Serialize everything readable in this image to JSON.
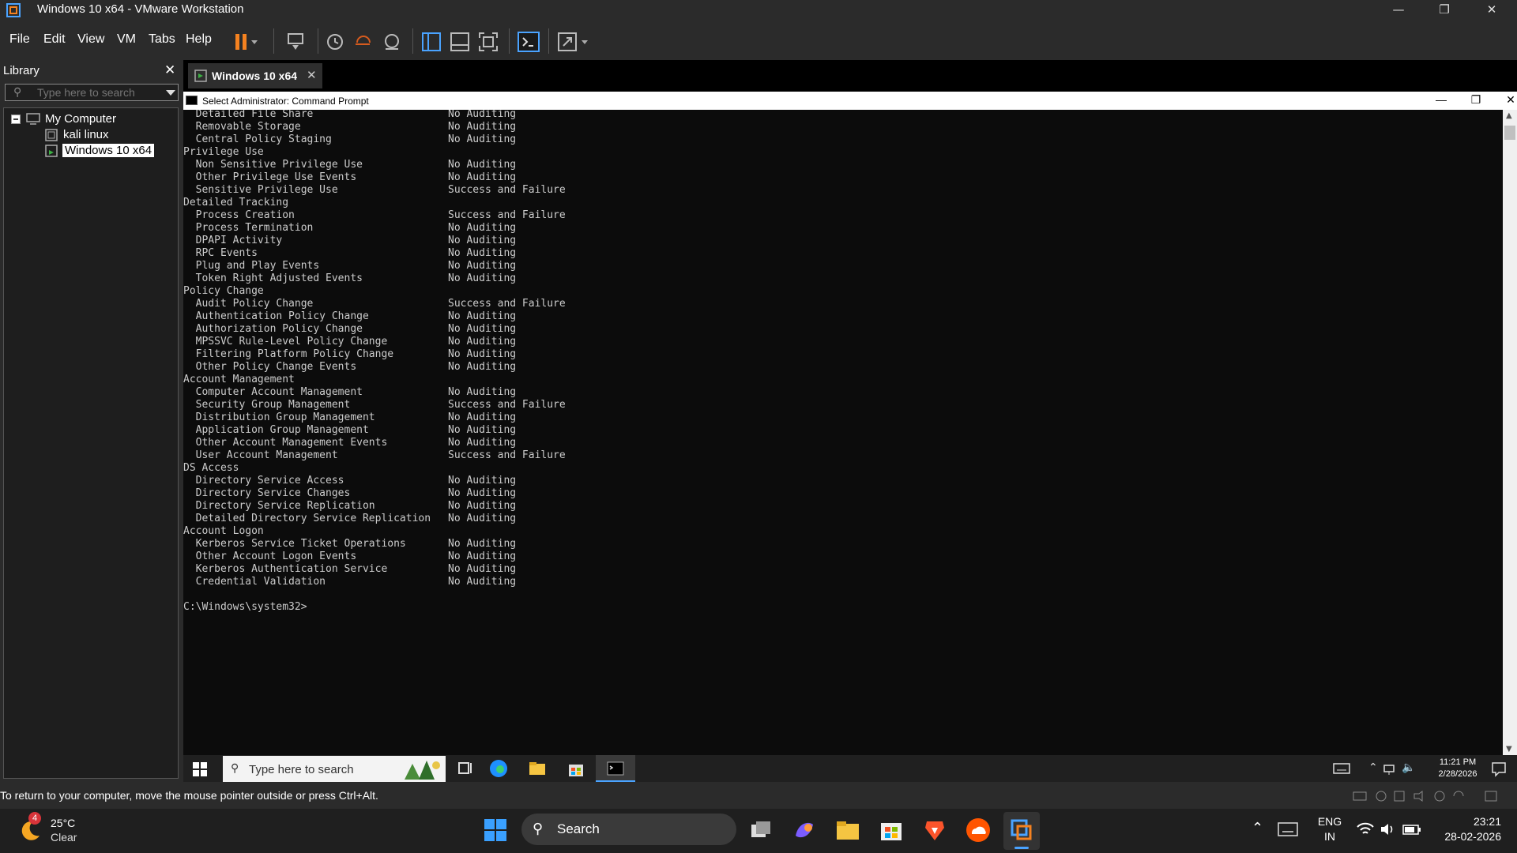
{
  "window": {
    "title": "Windows 10 x64 - VMware Workstation"
  },
  "menus": [
    "File",
    "Edit",
    "View",
    "VM",
    "Tabs",
    "Help"
  ],
  "library": {
    "header": "Library",
    "search_placeholder": "Type here to search",
    "tree": {
      "root": "My Computer",
      "items": [
        "kali linux",
        "Windows 10 x64"
      ]
    }
  },
  "vm_tab": {
    "label": "Windows 10 x64"
  },
  "cmd": {
    "title": "Select Administrator: Command Prompt",
    "lines": [
      {
        "name": "  Detailed File Share",
        "setting": "No Auditing"
      },
      {
        "name": "  Removable Storage",
        "setting": "No Auditing"
      },
      {
        "name": "  Central Policy Staging",
        "setting": "No Auditing"
      },
      {
        "name": "Privilege Use",
        "setting": ""
      },
      {
        "name": "  Non Sensitive Privilege Use",
        "setting": "No Auditing"
      },
      {
        "name": "  Other Privilege Use Events",
        "setting": "No Auditing"
      },
      {
        "name": "  Sensitive Privilege Use",
        "setting": "Success and Failure"
      },
      {
        "name": "Detailed Tracking",
        "setting": ""
      },
      {
        "name": "  Process Creation",
        "setting": "Success and Failure"
      },
      {
        "name": "  Process Termination",
        "setting": "No Auditing"
      },
      {
        "name": "  DPAPI Activity",
        "setting": "No Auditing"
      },
      {
        "name": "  RPC Events",
        "setting": "No Auditing"
      },
      {
        "name": "  Plug and Play Events",
        "setting": "No Auditing"
      },
      {
        "name": "  Token Right Adjusted Events",
        "setting": "No Auditing"
      },
      {
        "name": "Policy Change",
        "setting": ""
      },
      {
        "name": "  Audit Policy Change",
        "setting": "Success and Failure"
      },
      {
        "name": "  Authentication Policy Change",
        "setting": "No Auditing"
      },
      {
        "name": "  Authorization Policy Change",
        "setting": "No Auditing"
      },
      {
        "name": "  MPSSVC Rule-Level Policy Change",
        "setting": "No Auditing"
      },
      {
        "name": "  Filtering Platform Policy Change",
        "setting": "No Auditing"
      },
      {
        "name": "  Other Policy Change Events",
        "setting": "No Auditing"
      },
      {
        "name": "Account Management",
        "setting": ""
      },
      {
        "name": "  Computer Account Management",
        "setting": "No Auditing"
      },
      {
        "name": "  Security Group Management",
        "setting": "Success and Failure"
      },
      {
        "name": "  Distribution Group Management",
        "setting": "No Auditing"
      },
      {
        "name": "  Application Group Management",
        "setting": "No Auditing"
      },
      {
        "name": "  Other Account Management Events",
        "setting": "No Auditing"
      },
      {
        "name": "  User Account Management",
        "setting": "Success and Failure"
      },
      {
        "name": "DS Access",
        "setting": ""
      },
      {
        "name": "  Directory Service Access",
        "setting": "No Auditing"
      },
      {
        "name": "  Directory Service Changes",
        "setting": "No Auditing"
      },
      {
        "name": "  Directory Service Replication",
        "setting": "No Auditing"
      },
      {
        "name": "  Detailed Directory Service Replication",
        "setting": "No Auditing"
      },
      {
        "name": "Account Logon",
        "setting": ""
      },
      {
        "name": "  Kerberos Service Ticket Operations",
        "setting": "No Auditing"
      },
      {
        "name": "  Other Account Logon Events",
        "setting": "No Auditing"
      },
      {
        "name": "  Kerberos Authentication Service",
        "setting": "No Auditing"
      },
      {
        "name": "  Credential Validation",
        "setting": "No Auditing"
      },
      {
        "name": "",
        "setting": ""
      },
      {
        "name": "C:\\Windows\\system32>",
        "setting": ""
      }
    ]
  },
  "guest_taskbar": {
    "search_placeholder": "Type here to search",
    "time": "11:21 PM",
    "date": "2/28/2026"
  },
  "status_bar": {
    "text": "To return to your computer, move the mouse pointer outside or press Ctrl+Alt."
  },
  "host_taskbar": {
    "weather_temp": "25°C",
    "weather_desc": "Clear",
    "weather_badge": "4",
    "search_label": "Search",
    "lang_top": "ENG",
    "lang_bottom": "IN",
    "time": "23:21",
    "date": "28-02-2026"
  },
  "colors": {
    "accent": "#f58220",
    "vm_blue": "#1e90ff",
    "console_bg": "#0c0c0c"
  }
}
